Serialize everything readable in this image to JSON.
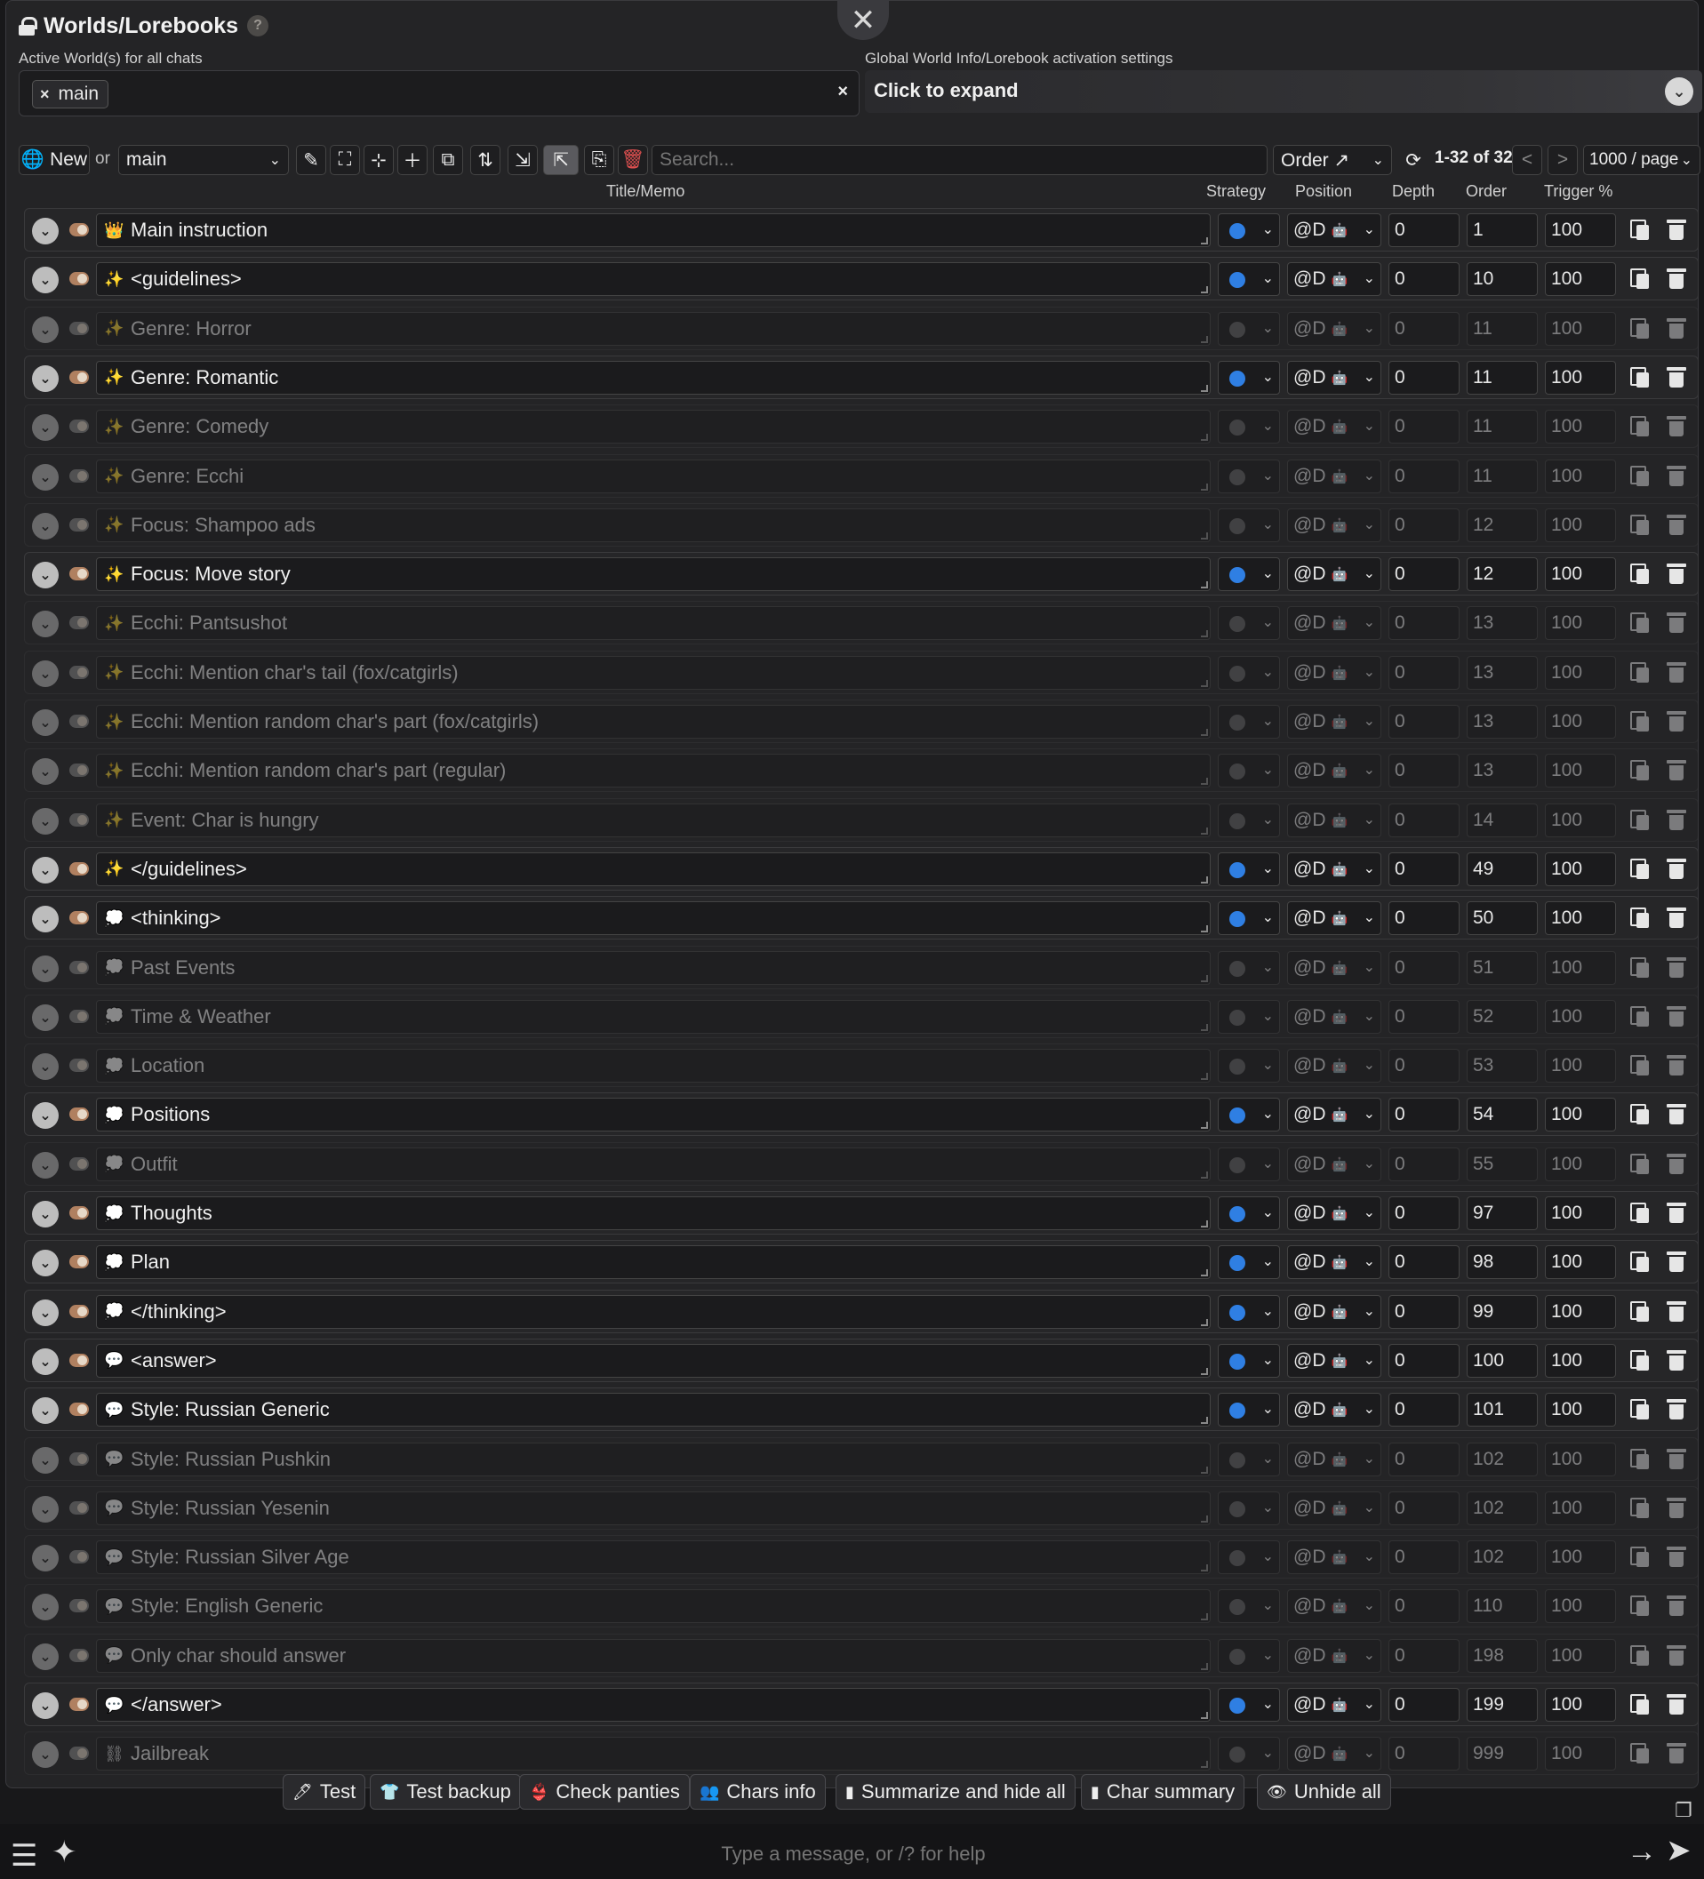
{
  "header": {
    "title": "Worlds/Lorebooks",
    "help": "?",
    "close": "✕"
  },
  "active": {
    "label": "Active World(s) for all chats",
    "tag": "main",
    "tag_x": "×",
    "clear": "×"
  },
  "global": {
    "label": "Global World Info/Lorebook activation settings",
    "expand": "Click to expand",
    "chev": "⌄"
  },
  "toolbar": {
    "new_label": "New",
    "or_label": "or",
    "world_select": "main",
    "search_placeholder": "Search...",
    "sort_select": "Order ↗",
    "paging": "1-32 of 32",
    "prev": "<",
    "next": ">",
    "per_page": "1000 / page"
  },
  "columns": {
    "title": "Title/Memo",
    "strategy": "Strategy",
    "position": "Position",
    "depth": "Depth",
    "order": "Order",
    "trigger": "Trigger %"
  },
  "entries": [
    {
      "title": "Main instruction",
      "icon": "👑",
      "pos": "@D",
      "depth": "0",
      "order": "1",
      "trigger": "100"
    },
    {
      "title": "<guidelines>",
      "icon": "✨",
      "pos": "@D",
      "depth": "0",
      "order": "10",
      "trigger": "100"
    },
    {
      "title": "Genre: Horror",
      "icon": "✨",
      "pos": "@D",
      "depth": "0",
      "order": "11",
      "trigger": "100"
    },
    {
      "title": "Genre: Romantic",
      "icon": "✨",
      "pos": "@D",
      "depth": "0",
      "order": "11",
      "trigger": "100"
    },
    {
      "title": "Genre: Comedy",
      "icon": "✨",
      "pos": "@D",
      "depth": "0",
      "order": "11",
      "trigger": "100"
    },
    {
      "title": "Genre: Ecchi",
      "icon": "✨",
      "pos": "@D",
      "depth": "0",
      "order": "11",
      "trigger": "100"
    },
    {
      "title": "Focus: Shampoo ads",
      "icon": "✨",
      "pos": "@D",
      "depth": "0",
      "order": "12",
      "trigger": "100"
    },
    {
      "title": "Focus: Move story",
      "icon": "✨",
      "pos": "@D",
      "depth": "0",
      "order": "12",
      "trigger": "100"
    },
    {
      "title": "Ecchi: Pantsushot",
      "icon": "✨",
      "pos": "@D",
      "depth": "0",
      "order": "13",
      "trigger": "100"
    },
    {
      "title": "Ecchi: Mention char's tail (fox/catgirls)",
      "icon": "✨",
      "pos": "@D",
      "depth": "0",
      "order": "13",
      "trigger": "100"
    },
    {
      "title": "Ecchi: Mention random char's part (fox/catgirls)",
      "icon": "✨",
      "pos": "@D",
      "depth": "0",
      "order": "13",
      "trigger": "100"
    },
    {
      "title": "Ecchi: Mention random char's part (regular)",
      "icon": "✨",
      "pos": "@D",
      "depth": "0",
      "order": "13",
      "trigger": "100"
    },
    {
      "title": "Event: Char is hungry",
      "icon": "✨",
      "pos": "@D",
      "depth": "0",
      "order": "14",
      "trigger": "100"
    },
    {
      "title": "</guidelines>",
      "icon": "✨",
      "pos": "@D",
      "depth": "0",
      "order": "49",
      "trigger": "100"
    },
    {
      "title": "<thinking>",
      "icon": "💭",
      "pos": "@D",
      "depth": "0",
      "order": "50",
      "trigger": "100"
    },
    {
      "title": "Past Events",
      "icon": "💭",
      "pos": "@D",
      "depth": "0",
      "order": "51",
      "trigger": "100"
    },
    {
      "title": "Time & Weather",
      "icon": "💭",
      "pos": "@D",
      "depth": "0",
      "order": "52",
      "trigger": "100"
    },
    {
      "title": "Location",
      "icon": "💭",
      "pos": "@D",
      "depth": "0",
      "order": "53",
      "trigger": "100"
    },
    {
      "title": "Positions",
      "icon": "💭",
      "pos": "@D",
      "depth": "0",
      "order": "54",
      "trigger": "100"
    },
    {
      "title": "Outfit",
      "icon": "💭",
      "pos": "@D",
      "depth": "0",
      "order": "55",
      "trigger": "100"
    },
    {
      "title": "Thoughts",
      "icon": "💭",
      "pos": "@D",
      "depth": "0",
      "order": "97",
      "trigger": "100"
    },
    {
      "title": "Plan",
      "icon": "💭",
      "pos": "@D",
      "depth": "0",
      "order": "98",
      "trigger": "100"
    },
    {
      "title": "</thinking>",
      "icon": "💭",
      "pos": "@D",
      "depth": "0",
      "order": "99",
      "trigger": "100"
    },
    {
      "title": "<answer>",
      "icon": "💬",
      "pos": "@D",
      "depth": "0",
      "order": "100",
      "trigger": "100"
    },
    {
      "title": "Style: Russian Generic",
      "icon": "💬",
      "pos": "@D",
      "depth": "0",
      "order": "101",
      "trigger": "100"
    },
    {
      "title": "Style: Russian Pushkin",
      "icon": "💬",
      "pos": "@D",
      "depth": "0",
      "order": "102",
      "trigger": "100"
    },
    {
      "title": "Style: Russian Yesenin",
      "icon": "💬",
      "pos": "@D",
      "depth": "0",
      "order": "102",
      "trigger": "100"
    },
    {
      "title": "Style: Russian Silver Age",
      "icon": "💬",
      "pos": "@D",
      "depth": "0",
      "order": "102",
      "trigger": "100"
    },
    {
      "title": "Style: English Generic",
      "icon": "💬",
      "pos": "@D",
      "depth": "0",
      "order": "110",
      "trigger": "100"
    },
    {
      "title": "Only char should answer",
      "icon": "💬",
      "pos": "@D",
      "depth": "0",
      "order": "198",
      "trigger": "100"
    },
    {
      "title": "</answer>",
      "icon": "💬",
      "pos": "@D",
      "depth": "0",
      "order": "199",
      "trigger": "100"
    },
    {
      "title": "Jailbreak",
      "icon": "⛓",
      "pos": "@D",
      "depth": "0",
      "order": "999",
      "trigger": "100"
    }
  ],
  "entry_enabled": [
    true,
    true,
    false,
    true,
    false,
    false,
    false,
    true,
    false,
    false,
    false,
    false,
    false,
    true,
    true,
    false,
    false,
    false,
    true,
    false,
    true,
    true,
    true,
    true,
    true,
    false,
    false,
    false,
    false,
    false,
    true,
    false
  ],
  "quick_replies": [
    {
      "icon": "🖊",
      "label": "Test"
    },
    {
      "icon": "👕",
      "label": "Test backup"
    },
    {
      "icon": "👙",
      "label": "Check panties"
    },
    {
      "icon": "👥",
      "label": "Chars info"
    },
    {
      "icon": "▮",
      "label": "Summarize and hide all"
    },
    {
      "icon": "▮",
      "label": "Char summary"
    },
    {
      "icon": "👁",
      "label": "Unhide all"
    }
  ],
  "message": {
    "placeholder": "Type a message, or /? for help"
  },
  "colors": {
    "strategy_dot": "#2f7fe3",
    "toggle_on": "#b08060",
    "panel_bg": "#242426"
  }
}
